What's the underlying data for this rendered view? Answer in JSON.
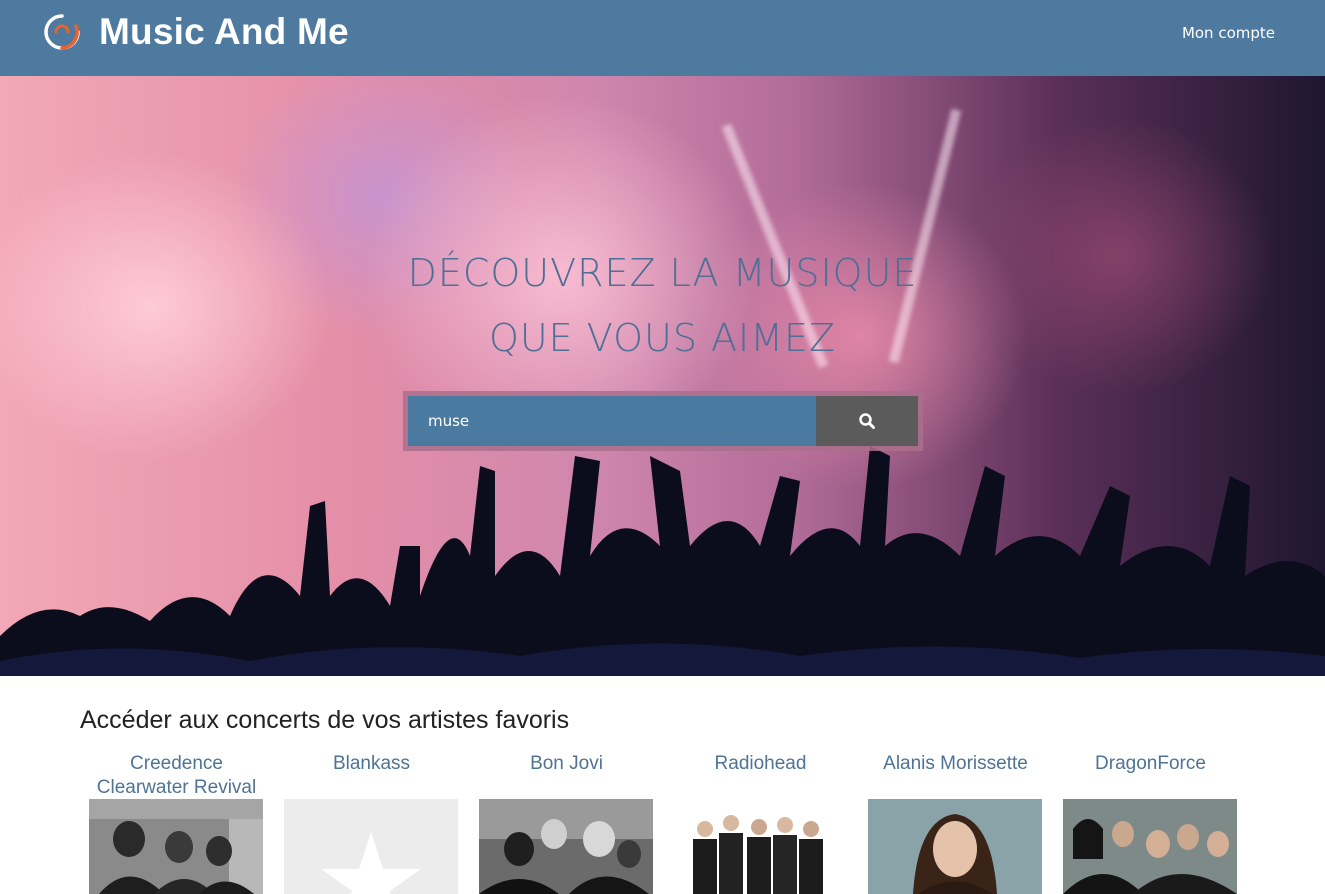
{
  "header": {
    "brand": "Music And Me",
    "account_label": "Mon compte",
    "logo_icon": "swirl-logo-icon"
  },
  "hero": {
    "line1": "DÉCOUVREZ LA MUSIQUE",
    "line2": "QUE VOUS AIMEZ",
    "search": {
      "value": "muse",
      "button_icon": "search-icon"
    }
  },
  "favorites": {
    "title": "Accéder aux concerts de vos artistes favoris",
    "artists": [
      {
        "name": "Creedence Clearwater Revival"
      },
      {
        "name": "Blankass"
      },
      {
        "name": "Bon Jovi"
      },
      {
        "name": "Radiohead"
      },
      {
        "name": "Alanis Morissette"
      },
      {
        "name": "DragonForce"
      }
    ]
  },
  "colors": {
    "header_bg": "#4e7aa0",
    "tagline": "#4f6f95",
    "search_bg": "#4b7aa0",
    "search_btn": "#5b5b5b",
    "artist_link": "#4f7395"
  }
}
